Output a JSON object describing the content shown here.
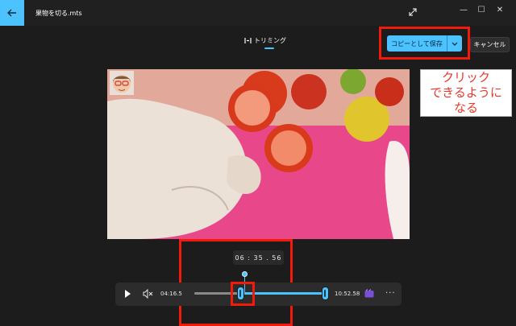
{
  "window": {
    "title": "果物を切る.mts",
    "minimize_glyph": "—",
    "maximize_glyph": "☐",
    "close_glyph": "✕"
  },
  "tabs": [
    {
      "label": "トリミング",
      "icon": "trim-icon",
      "active": true
    }
  ],
  "actions": {
    "save_copy_label": "コピーとして保存",
    "cancel_label": "キャンセル"
  },
  "annotation": {
    "line1": "クリック",
    "line2": "できるように",
    "line3": "なる",
    "color": "#e8382c"
  },
  "player": {
    "playhead_time": "06 : 35 . 56",
    "trim_start": "04:16.5",
    "trim_end": "10:52.58",
    "more_glyph": "···"
  },
  "colors": {
    "accent": "#4cc2ff",
    "highlight_box": "#f21a08",
    "background": "#1c1c1c"
  }
}
